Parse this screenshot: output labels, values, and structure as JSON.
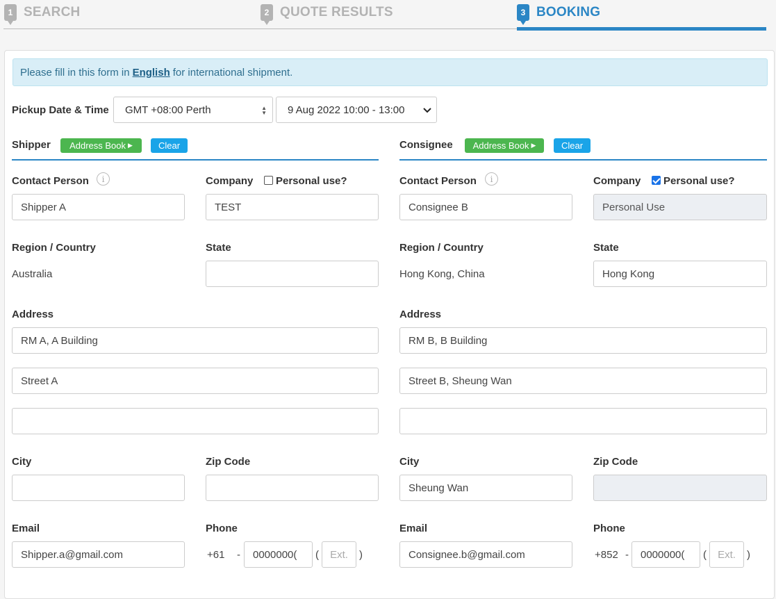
{
  "steps": [
    {
      "num": "1",
      "label": "SEARCH"
    },
    {
      "num": "2",
      "label": "QUOTE RESULTS"
    },
    {
      "num": "3",
      "label": "BOOKING"
    }
  ],
  "notice": {
    "before": "Please fill in this form in",
    "link": "English",
    "after": "for international shipment."
  },
  "pickup": {
    "label": "Pickup Date & Time",
    "timezone": "GMT +08:00 Perth",
    "slot": "9 Aug 2022 10:00 - 13:00"
  },
  "shipper": {
    "title": "Shipper",
    "address_book": "Address Book",
    "clear": "Clear",
    "contact_label": "Contact Person",
    "contact": "Shipper A",
    "company_label": "Company",
    "personal_label": "Personal use?",
    "personal_checked": false,
    "company": "TEST",
    "region_label": "Region / Country",
    "region": "Australia",
    "state_label": "State",
    "state": "",
    "address_label": "Address",
    "address1": "RM A, A Building",
    "address2": "Street A",
    "address3": "",
    "city_label": "City",
    "city": "",
    "zip_label": "Zip Code",
    "zip": "",
    "email_label": "Email",
    "email": "Shipper.a@gmail.com",
    "phone_label": "Phone",
    "phone_code": "+61",
    "dash": "-",
    "phone": "0000000(",
    "paren_open": "(",
    "ext": "Ext.",
    "paren_close": ")"
  },
  "consignee": {
    "title": "Consignee",
    "address_book": "Address Book",
    "clear": "Clear",
    "contact_label": "Contact Person",
    "contact": "Consignee B",
    "company_label": "Company",
    "personal_label": "Personal use?",
    "personal_checked": true,
    "company": "Personal Use",
    "region_label": "Region / Country",
    "region": "Hong Kong, China",
    "state_label": "State",
    "state": "Hong Kong",
    "address_label": "Address",
    "address1": "RM B, B Building",
    "address2": "Street B, Sheung Wan",
    "address3": "",
    "city_label": "City",
    "city": "Sheung Wan",
    "zip_label": "Zip Code",
    "zip": "",
    "email_label": "Email",
    "email": "Consignee.b@gmail.com",
    "phone_label": "Phone",
    "phone_code": "+852",
    "dash": "-",
    "phone": "0000000(",
    "paren_open": "(",
    "ext": "Ext.",
    "paren_close": ")"
  },
  "colors": {
    "accent": "#2b86c5",
    "green": "#4cb64f",
    "blue": "#1aa4e8",
    "notice_bg": "#d9eef7"
  }
}
